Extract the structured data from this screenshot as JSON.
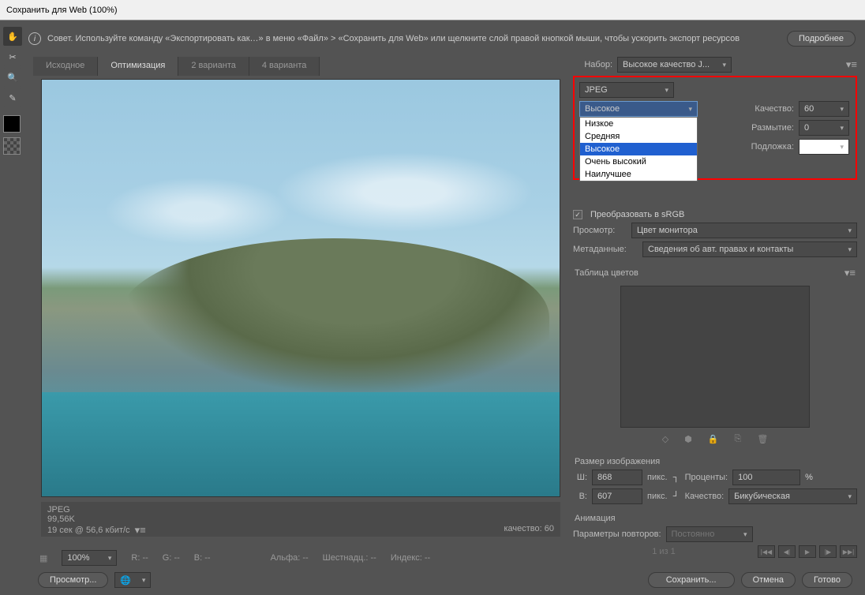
{
  "title": "Сохранить для Web (100%)",
  "tip_text": "Совет. Используйте команду «Экспортировать как…» в меню «Файл» > «Сохранить для Web» или щелкните слой правой кнопкой мыши, чтобы ускорить экспорт ресурсов",
  "more_btn": "Подробнее",
  "tabs": {
    "source": "Исходное",
    "optim": "Оптимизация",
    "two": "2 варианта",
    "four": "4 варианта"
  },
  "preview_info": {
    "format": "JPEG",
    "size": "99,56K",
    "time": "19 сек @ 56,6 кбит/с",
    "quality_lbl": "качество: 60"
  },
  "preset": {
    "label": "Набор:",
    "value": "Высокое качество J..."
  },
  "format_dd": "JPEG",
  "quality_dd": {
    "value": "Высокое",
    "options": [
      "Низкое",
      "Средняя",
      "Высокое",
      "Очень высокий",
      "Наилучшее"
    ]
  },
  "quality": {
    "label": "Качество:",
    "value": "60"
  },
  "blur": {
    "label": "Размытие:",
    "value": "0"
  },
  "matte": {
    "label": "Подложка:"
  },
  "srgb": {
    "label": "Преобразовать в sRGB"
  },
  "view": {
    "label": "Просмотр:",
    "value": "Цвет монитора"
  },
  "meta": {
    "label": "Метаданные:",
    "value": "Сведения об авт. правах и контакты"
  },
  "palette_hdr": "Таблица цветов",
  "size_hdr": "Размер изображения",
  "w": {
    "label": "Ш:",
    "value": "868",
    "unit": "пикс."
  },
  "h": {
    "label": "В:",
    "value": "607",
    "unit": "пикс."
  },
  "percent": {
    "label": "Проценты:",
    "value": "100",
    "unit": "%"
  },
  "resample": {
    "label": "Качество:",
    "value": "Бикубическая"
  },
  "anim_hdr": "Анимация",
  "loop": {
    "label": "Параметры повторов:",
    "value": "Постоянно"
  },
  "frame": "1 из 1",
  "zoom": "100%",
  "readout": {
    "r": "R: --",
    "g": "G: --",
    "b": "B: --",
    "alpha": "Альфа: --",
    "hex": "Шестнадц.: --",
    "index": "Индекс: --"
  },
  "preview_btn": "Просмотр...",
  "save_btn": "Сохранить...",
  "cancel_btn": "Отмена",
  "done_btn": "Готово"
}
